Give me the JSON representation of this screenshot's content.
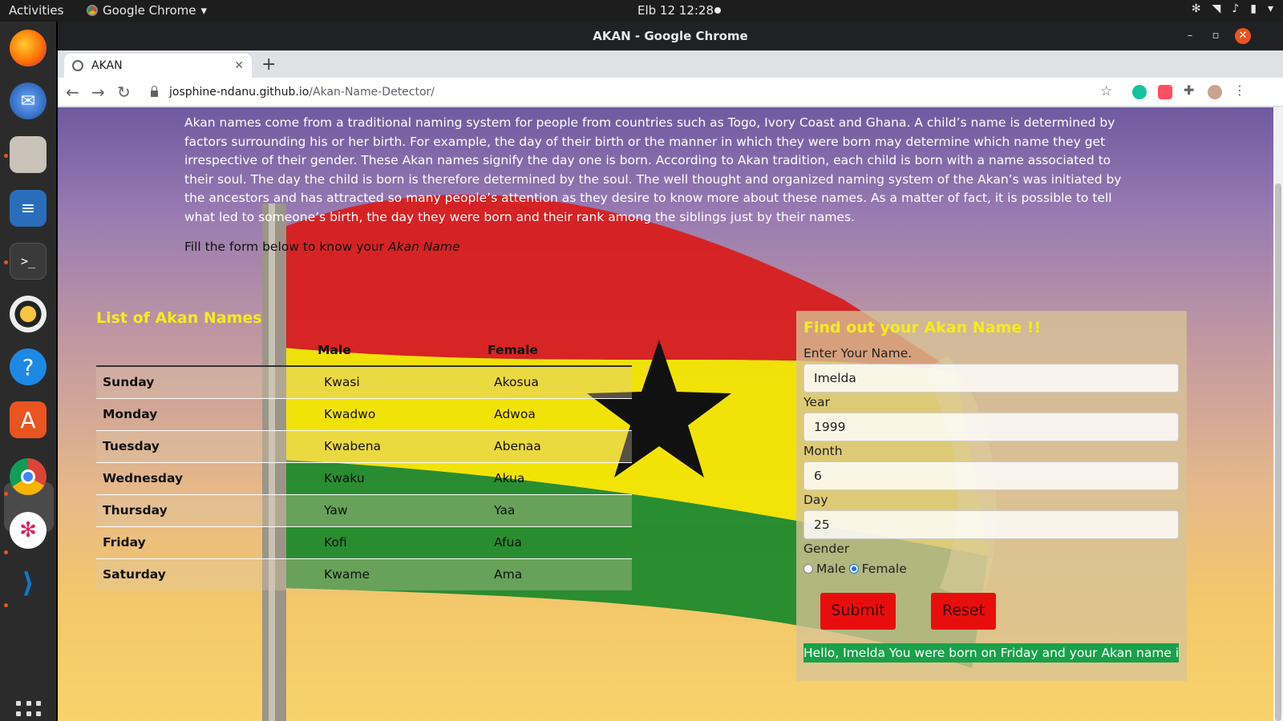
{
  "topbar": {
    "activities": "Activities",
    "app_name": "Google Chrome",
    "clock": "Elb 12  12:28"
  },
  "window": {
    "title": "AKAN - Google Chrome"
  },
  "tab": {
    "title": "AKAN"
  },
  "address": {
    "host": "josphine-ndanu.github.io",
    "path": "/Akan-Name-Detector/"
  },
  "page": {
    "intro": "Akan names come from a traditional naming system for people from countries such as Togo, Ivory Coast and Ghana. A child’s name is determined by factors surrounding his or her birth. For example, the day of their birth or the manner in which they were born may determine which name they get irrespective of their gender. These Akan names signify the day one is born. According to Akan tradition, each child is born with a name associated to their soul. The day the child is born is therefore determined by the soul. The well thought and organized naming system of the Akan’s was initiated by the ancestors and has attracted so many people’s attention as they desire to know more about these names. As a matter of fact, it is possible to tell what led to someone’s birth, the day they were born and their rank among the siblings just by their names.",
    "fill_prefix": "Fill the form below to know your ",
    "fill_emph": "Akan Name"
  },
  "list": {
    "title": "List of Akan Names",
    "headers": [
      "",
      "Male",
      "Female"
    ],
    "rows": [
      [
        "Sunday",
        "Kwasi",
        "Akosua"
      ],
      [
        "Monday",
        "Kwadwo",
        "Adwoa"
      ],
      [
        "Tuesday",
        "Kwabena",
        "Abenaa"
      ],
      [
        "Wednesday",
        "Kwaku",
        "Akua"
      ],
      [
        "Thursday",
        "Yaw",
        "Yaa"
      ],
      [
        "Friday",
        "Kofi",
        "Afua"
      ],
      [
        "Saturday",
        "Kwame",
        "Ama"
      ]
    ]
  },
  "form": {
    "title": "Find out your Akan Name !!",
    "name_label": "Enter Your Name.",
    "name_value": "Imelda",
    "year_label": "Year",
    "year_value": "1999",
    "month_label": "Month",
    "month_value": "6",
    "day_label": "Day",
    "day_value": "25",
    "gender_label": "Gender",
    "male_label": "Male",
    "female_label": "Female",
    "selected_gender": "Female",
    "submit_label": "Submit",
    "reset_label": "Reset",
    "result": "Hello, Imelda You were born on Friday and your Akan name is Afua"
  },
  "colors": {
    "heading_yellow": "#f5ec1e",
    "button_red": "#e90e0e",
    "result_green": "#1aa04a"
  }
}
